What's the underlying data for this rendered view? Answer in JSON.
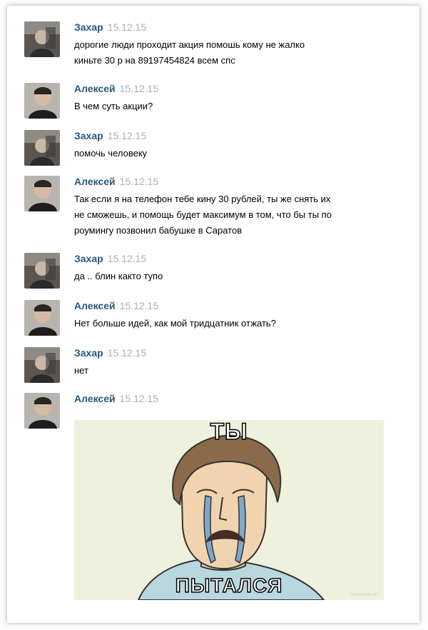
{
  "messages": [
    {
      "author": "Захар",
      "date": "15.12.15",
      "avatar": "zakhar",
      "lines": [
        "дорогие люди проходит акция помошь кому не жалко",
        "киньте 30 р на 89197454824 всем спс"
      ]
    },
    {
      "author": "Алексей",
      "date": "15.12.15",
      "avatar": "aleksei",
      "lines": [
        "В чем суть акции?"
      ]
    },
    {
      "author": "Захар",
      "date": "15.12.15",
      "avatar": "zakhar",
      "lines": [
        "помочь человеку"
      ]
    },
    {
      "author": "Алексей",
      "date": "15.12.15",
      "avatar": "aleksei",
      "lines": [
        "Так если я на телефон тебе кину 30 рублей, ты же снять их",
        "не сможешь, и помощь будет максимум в том, что бы ты по",
        "роумингу позвонил бабушке в Саратов"
      ]
    },
    {
      "author": "Захар",
      "date": "15.12.15",
      "avatar": "zakhar",
      "lines": [
        "да .. блин както тупо"
      ]
    },
    {
      "author": "Алексей",
      "date": "15.12.15",
      "avatar": "aleksei",
      "lines": [
        "Нет больше идей, как мой тридцатник отжать?"
      ]
    },
    {
      "author": "Захар",
      "date": "15.12.15",
      "avatar": "zakhar",
      "lines": [
        "нет"
      ]
    },
    {
      "author": "Алексей",
      "date": "15.12.15",
      "avatar": "aleksei",
      "lines": []
    }
  ],
  "meme": {
    "top_text": "ТЫ",
    "bottom_text": "ПЫТАЛСЯ",
    "watermark": "memesmix.net",
    "bg_color": "#eef1dc",
    "hair_color": "#8a6a4a",
    "skin_color": "#f1d3b0",
    "shirt_color": "#b9d7df"
  }
}
